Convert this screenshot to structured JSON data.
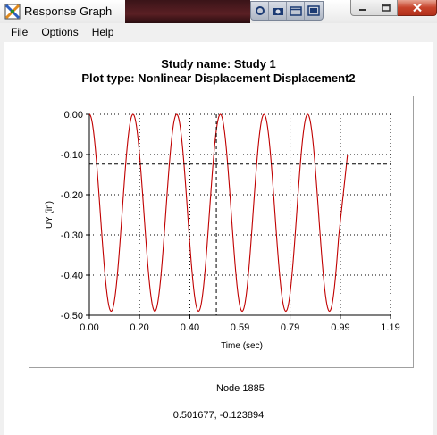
{
  "window": {
    "title": "Response Graph"
  },
  "menu": {
    "items": [
      "File",
      "Options",
      "Help"
    ]
  },
  "header": {
    "study_line": "Study name: Study 1",
    "plot_type_line": "Plot type: Nonlinear Displacement Displacement2"
  },
  "chart_data": {
    "type": "line",
    "xlabel": "Time (sec)",
    "ylabel": "UY (in)",
    "xlim": [
      0.0,
      1.19
    ],
    "ylim": [
      -0.5,
      0.0
    ],
    "x_ticks": [
      "0.00",
      "0.20",
      "0.40",
      "0.59",
      "0.79",
      "0.99",
      "1.19"
    ],
    "x_tick_values": [
      0.0,
      0.198,
      0.397,
      0.595,
      0.793,
      0.992,
      1.19
    ],
    "y_ticks": [
      "0.00",
      "-0.10",
      "-0.20",
      "-0.30",
      "-0.40",
      "-0.50"
    ],
    "y_tick_values": [
      0.0,
      -0.1,
      -0.2,
      -0.3,
      -0.4,
      -0.5
    ],
    "grid": true,
    "series": [
      {
        "name": "Node 1885",
        "color": "#c00000",
        "description_period_sec": 0.1725,
        "amplitude": 0.245,
        "offset": -0.245,
        "x_end": 1.02,
        "y_end": -0.1
      }
    ],
    "cursor": {
      "x": 0.501677,
      "y": -0.123894
    },
    "legend_position": "bottom-center"
  },
  "legend": {
    "label": "Node 1885"
  },
  "cursor_readout": "0.501677, -0.123894",
  "colors": {
    "series": "#c00000",
    "grid": "#000000",
    "close_button": "#c7432b"
  }
}
